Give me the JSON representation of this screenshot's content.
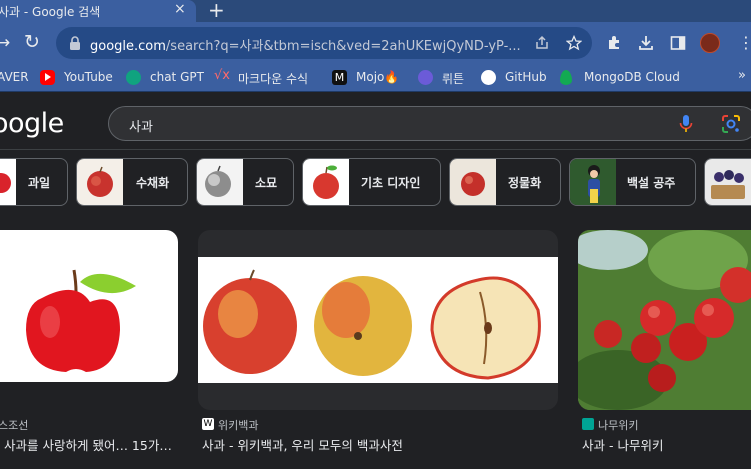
{
  "tab": {
    "title": "사과 - Google 검색",
    "close_glyph": "×",
    "new_tab_glyph": "+"
  },
  "toolbar": {
    "url_host": "google.com",
    "url_rest": "/search?q=사과&tbm=isch&ved=2ahUKEwjQyND-yP-..."
  },
  "bookmarks": [
    {
      "label": "AVER",
      "color": "#03c75a"
    },
    {
      "label": "YouTube",
      "color": "#ff0000"
    },
    {
      "label": "chat GPT",
      "color": "#10a37f"
    },
    {
      "label": "마크다운 수식",
      "color": "#8b1a1a"
    },
    {
      "label": "Mojo🔥",
      "color": "#111111"
    },
    {
      "label": "뤼튼",
      "color": "#6b5bd8"
    },
    {
      "label": "GitHub",
      "color": "#ffffff"
    },
    {
      "label": "MongoDB Cloud",
      "color": "#13aa52"
    }
  ],
  "google": {
    "logo": "oogle",
    "query": "사과"
  },
  "chips": [
    {
      "label": "과일"
    },
    {
      "label": "수채화"
    },
    {
      "label": "소묘"
    },
    {
      "label": "기초 디자인"
    },
    {
      "label": "정물화"
    },
    {
      "label": "백설 공주"
    }
  ],
  "results": [
    {
      "source": "스조선",
      "title": "사과를 사랑하게 됐어… 15가…"
    },
    {
      "source": "위키백과",
      "title": "사과 - 위키백과, 우리 모두의 백과사전"
    },
    {
      "source": "나무위키",
      "title": "사과 - 나무위키"
    }
  ],
  "colors": {
    "accent": "#3b5fa0",
    "background": "#202124"
  }
}
